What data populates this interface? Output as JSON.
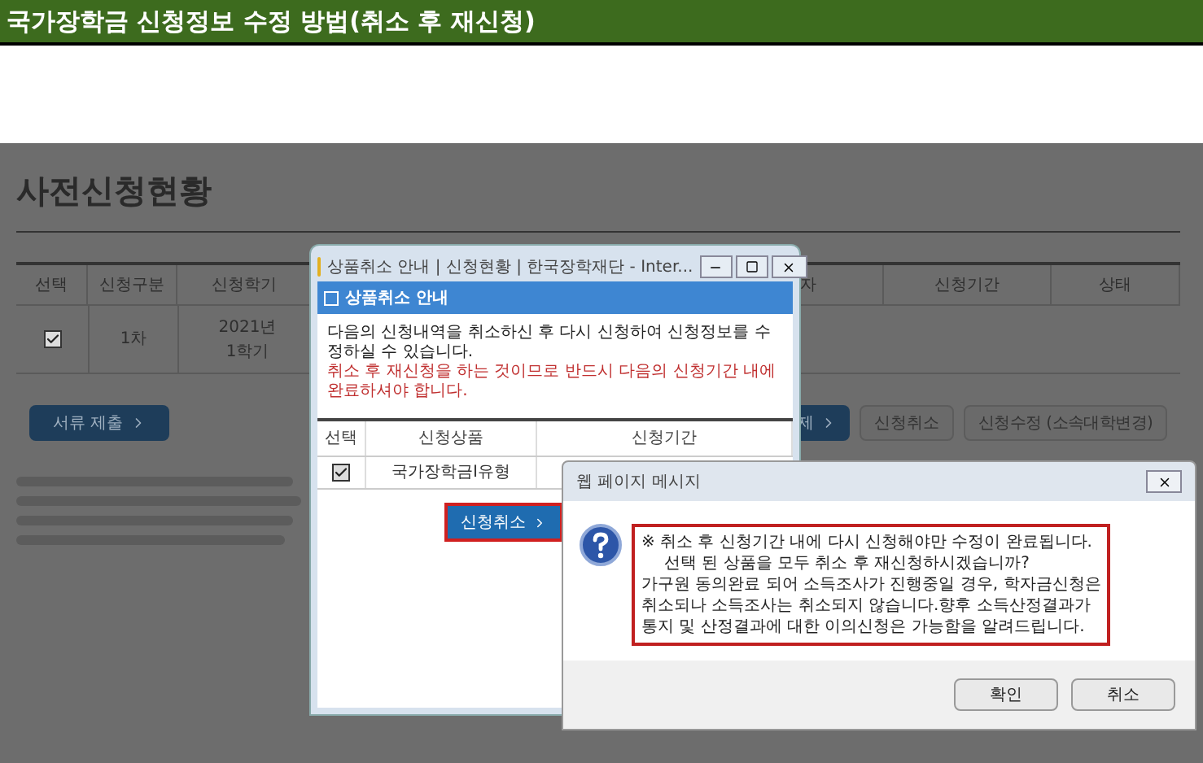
{
  "header": {
    "title": "국가장학금 신청정보 수정 방법(취소 후 재신청)"
  },
  "page": {
    "heading": "사전신청현황",
    "table": {
      "columns": [
        "선택",
        "신청구분",
        "신청학기",
        "자",
        "신청기간",
        "상태"
      ],
      "rows": [
        {
          "checked": true,
          "cells": [
            "",
            "1차",
            "2021년 1학기"
          ]
        }
      ]
    },
    "buttons": [
      {
        "kind": "primary",
        "label": "서류 제출"
      },
      {
        "kind": "primary",
        "label": "제"
      },
      {
        "kind": "secondary",
        "label": "신청취소"
      },
      {
        "kind": "secondary",
        "label": "신청수정 (소속대학변경)"
      }
    ]
  },
  "popup": {
    "title": "상품취소 안내 | 신청현황 | 한국장학재단 - Inter...",
    "header": "상품취소 안내",
    "notice": "다음의 신청내역을 취소하신 후 다시 신청하여 신청정보를 수정하실 수 있습니다.",
    "warning": "취소 후 재신청을 하는 것이므로 반드시 다음의 신청기간 내에 완료하셔야 합니다.",
    "table": {
      "columns": [
        "선택",
        "신청상품",
        "신청기간"
      ],
      "rows": [
        {
          "checked": true,
          "product": "국가장학금I유형"
        }
      ]
    },
    "button": {
      "label": "신청취소",
      "highlighted": true
    }
  },
  "dialog": {
    "title": "웹 페이지 메시지",
    "lines": [
      "※ 취소 후 신청기간 내에 다시 신청해야만 수정이 완료됩니다.",
      "선택 된 상품을 모두 취소 후 재신청하시겠습니까?",
      "가구원 동의완료 되어 소득조사가 진행중일 경우, 학자금신청은",
      "취소되나 소득조사는 취소되지 않습니다.향후 소득산정결과가",
      "통지 및 산정결과에 대한 이의신청은 가능함을 알려드립니다."
    ],
    "buttons": [
      "확인",
      "취소"
    ]
  }
}
